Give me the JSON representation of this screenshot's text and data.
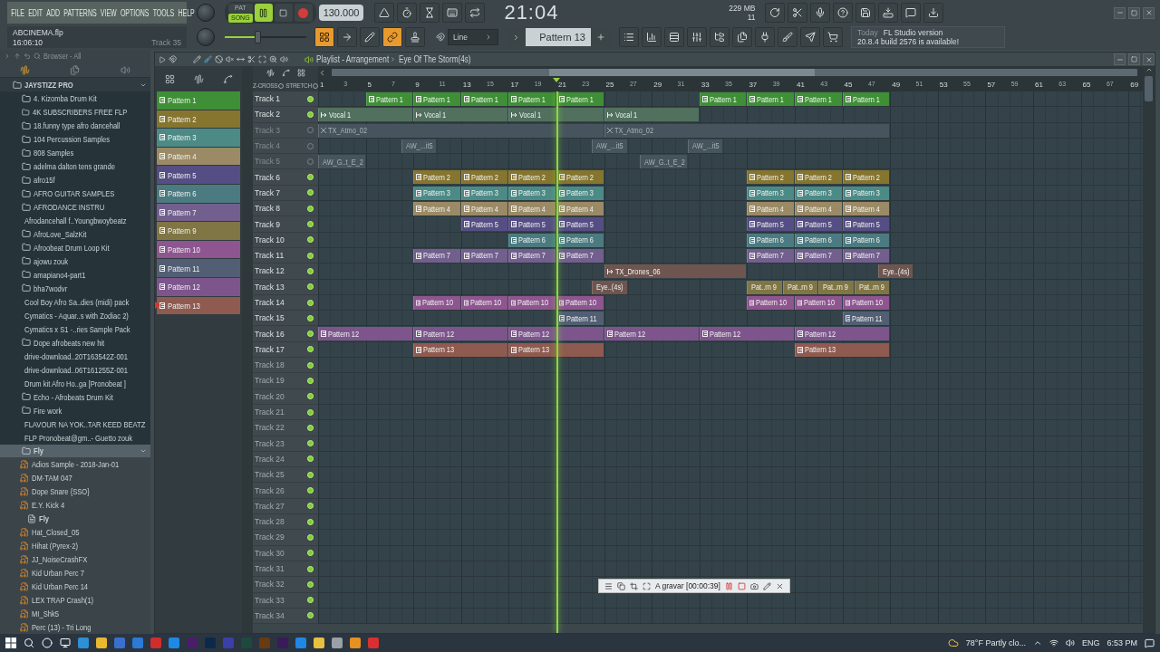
{
  "menu": [
    "FILE",
    "EDIT",
    "ADD",
    "PATTERNS",
    "VIEW",
    "OPTIONS",
    "TOOLS",
    "HELP"
  ],
  "project": {
    "file": "ABCINEMA.flp",
    "time": "16:06:10",
    "hint": "Track 35"
  },
  "modes": [
    {
      "label": "PAT",
      "selected": false
    },
    {
      "label": "SONG",
      "selected": true
    }
  ],
  "transport": {
    "playing": true,
    "tempo": "130.000"
  },
  "master_volume": {
    "level": 0.4
  },
  "clock": {
    "time": "21:04"
  },
  "memory": {
    "ram": "229 MB",
    "voices": "11"
  },
  "mode_buttons": [
    {
      "on": true
    },
    {
      "on": false
    },
    {
      "on": false
    },
    {
      "on": true
    },
    {
      "on": false
    }
  ],
  "snap": {
    "value": "Line"
  },
  "pattern_selector": {
    "value": "Pattern 13"
  },
  "news": {
    "day": "Today",
    "title": "FL Studio version",
    "text": "20.8.4 build 2576 is available!"
  },
  "browser": {
    "title": "Browser - All",
    "tree": [
      {
        "label": "JAYSTIZZ PRO",
        "kind": "folder",
        "expanded": true,
        "selected": false,
        "children": [
          {
            "label": "4. Kizomba Drum Kit",
            "kind": "folder",
            "expanded": false,
            "selected": false
          },
          {
            "label": "4K SUBSCRIBERS FREE FLP",
            "kind": "folder",
            "expanded": false,
            "selected": false
          },
          {
            "label": "18.funny type afro dancehall",
            "kind": "folder",
            "expanded": false,
            "selected": false
          },
          {
            "label": "104 Percussion Samples",
            "kind": "folder",
            "expanded": false,
            "selected": false
          },
          {
            "label": "808 Samples",
            "kind": "folder",
            "expanded": false,
            "selected": false
          },
          {
            "label": "adelma dalton tens grande",
            "kind": "folder",
            "expanded": false,
            "selected": false
          },
          {
            "label": "afro15f",
            "kind": "folder",
            "expanded": false,
            "selected": false
          },
          {
            "label": "AFRO GUITAR SAMPLES",
            "kind": "folder",
            "expanded": false,
            "selected": false
          },
          {
            "label": "AFRODANCE INSTRU",
            "kind": "folder",
            "expanded": false,
            "selected": false
          },
          {
            "label": "Afrodancehall f..Youngbwoybeatz",
            "kind": "folder",
            "expanded": false,
            "selected": false
          },
          {
            "label": "AfroLove_SalzKit",
            "kind": "folder",
            "expanded": false,
            "selected": false
          },
          {
            "label": "Afroobeat Drum Loop Kit",
            "kind": "folder",
            "expanded": false,
            "selected": false
          },
          {
            "label": "ajowu zouk",
            "kind": "folder",
            "expanded": false,
            "selected": false
          },
          {
            "label": "amapiano4-part1",
            "kind": "folder",
            "expanded": false,
            "selected": false
          },
          {
            "label": "bha7wodvr",
            "kind": "folder",
            "expanded": false,
            "selected": false
          },
          {
            "label": "Cool Boy Afro Sa..dies (midi) pack",
            "kind": "folder",
            "expanded": false,
            "selected": false
          },
          {
            "label": "Cymatics - Aquar..s with Zodiac 2)",
            "kind": "folder",
            "expanded": false,
            "selected": false
          },
          {
            "label": "Cymatics x S1 -..ries Sample Pack",
            "kind": "folder",
            "expanded": false,
            "selected": false
          },
          {
            "label": "Dope afrobeats new hit",
            "kind": "folder",
            "expanded": false,
            "selected": false
          },
          {
            "label": "drive-download..20T163542Z-001",
            "kind": "folder",
            "expanded": false,
            "selected": false
          },
          {
            "label": "drive-download..06T161255Z-001",
            "kind": "folder",
            "expanded": false,
            "selected": false
          },
          {
            "label": "Drum kit Afro Ho..ga [Pronobeat ]",
            "kind": "folder",
            "expanded": false,
            "selected": false
          },
          {
            "label": "Echo - Afrobeats Drum Kit",
            "kind": "folder",
            "expanded": false,
            "selected": false
          },
          {
            "label": "Fire work",
            "kind": "folder",
            "expanded": false,
            "selected": false
          },
          {
            "label": "FLAVOUR NA YOK..TAR KEED BEATZ",
            "kind": "folder",
            "expanded": false,
            "selected": false
          },
          {
            "label": "FLP Pronobeat@gm..- Guetto zouk",
            "kind": "folder",
            "expanded": false,
            "selected": false
          },
          {
            "label": "Fly",
            "kind": "folder",
            "expanded": true,
            "selected": true,
            "children": [
              {
                "label": "Adios Sample - 2018-Jan-01",
                "kind": "audio",
                "selected": false
              },
              {
                "label": "DM-TAM 047",
                "kind": "audio",
                "selected": false
              },
              {
                "label": "Dope Snare {SSO}",
                "kind": "audio",
                "selected": false
              },
              {
                "label": "E.Y. Kick 4",
                "kind": "audio",
                "selected": false
              },
              {
                "label": "Fly",
                "kind": "document",
                "selected": false
              },
              {
                "label": "Hat_Closed_05",
                "kind": "audio",
                "selected": false
              },
              {
                "label": "Hihat (Pyrex-2)",
                "kind": "audio",
                "selected": false
              },
              {
                "label": "JJ_NoiseCrashFX",
                "kind": "audio",
                "selected": false
              },
              {
                "label": "Kid Urban Perc 7",
                "kind": "audio",
                "selected": false
              },
              {
                "label": "Kid Urban Perc 14",
                "kind": "audio",
                "selected": false
              },
              {
                "label": "LEX TRAP Crash(1)",
                "kind": "audio",
                "selected": false
              },
              {
                "label": "MI_Shk5",
                "kind": "audio",
                "selected": false
              },
              {
                "label": "Perc (13) - Tri Long",
                "kind": "audio",
                "selected": false
              }
            ]
          }
        ]
      }
    ]
  },
  "playlist": {
    "title": "Playlist - Arrangement",
    "song": "Eye Of The Storm(4s)",
    "zcross": "Z-CROSS",
    "stretch": "STRETCH"
  },
  "patterns": [
    {
      "label": "Pattern 1",
      "color": "#3e8f35",
      "selected": false
    },
    {
      "label": "Pattern 2",
      "color": "#85752f",
      "selected": false
    },
    {
      "label": "Pattern 3",
      "color": "#4c8a86",
      "selected": false
    },
    {
      "label": "Pattern 4",
      "color": "#9b8a66",
      "selected": false
    },
    {
      "label": "Pattern 5",
      "color": "#554e84",
      "selected": false
    },
    {
      "label": "Pattern 6",
      "color": "#4b7a80",
      "selected": false
    },
    {
      "label": "Pattern 7",
      "color": "#725f8e",
      "selected": false
    },
    {
      "label": "Pattern 9",
      "color": "#807545",
      "selected": false
    },
    {
      "label": "Pattern 10",
      "color": "#8e5590",
      "selected": false
    },
    {
      "label": "Pattern 11",
      "color": "#525e73",
      "selected": false
    },
    {
      "label": "Pattern 12",
      "color": "#7d558c",
      "selected": false
    },
    {
      "label": "Pattern 13",
      "color": "#8f5a50",
      "selected": true
    }
  ],
  "ruler": [
    "1",
    "3",
    "5",
    "7",
    "9",
    "11",
    "13",
    "15",
    "17",
    "19",
    "21",
    "23",
    "25",
    "27",
    "29",
    "31",
    "33",
    "35",
    "37",
    "39",
    "41",
    "43",
    "45",
    "47",
    "49",
    "51",
    "53",
    "55",
    "57",
    "59",
    "61",
    "63",
    "65",
    "67",
    "69"
  ],
  "tracks": [
    {
      "name": "Track 1",
      "muted": false,
      "color": "#3e8f35",
      "clips": [
        {
          "kind": "pattern",
          "label": "Pattern 1"
        },
        {
          "kind": "pattern",
          "label": "Pattern 1"
        },
        {
          "kind": "pattern",
          "label": "Pattern 1"
        },
        {
          "kind": "pattern",
          "label": "Pattern 1"
        },
        {
          "kind": "pattern",
          "label": "Pattern 1"
        },
        {
          "kind": "pattern",
          "label": "Pattern 1"
        },
        {
          "kind": "pattern",
          "label": "Pattern 1"
        },
        {
          "kind": "pattern",
          "label": "Pattern 1"
        },
        {
          "kind": "pattern",
          "label": "Pattern 1"
        }
      ]
    },
    {
      "name": "Track 2",
      "muted": false,
      "color": "#51705e",
      "clips": [
        {
          "kind": "audio",
          "label": "Vocal 1"
        },
        {
          "kind": "audio",
          "label": "Vocal 1"
        },
        {
          "kind": "audio",
          "label": "Vocal 1"
        },
        {
          "kind": "audio",
          "label": "Vocal 1"
        }
      ]
    },
    {
      "name": "Track 3",
      "muted": true,
      "color": "#46555d",
      "clips": [
        {
          "kind": "muted",
          "label": "TX_Atmo_02"
        },
        {
          "kind": "muted",
          "label": "TX_Atmo_02"
        }
      ]
    },
    {
      "name": "Track 4",
      "muted": true,
      "color": "#46555d",
      "clips": [
        {
          "kind": "muted",
          "label": "AW_...it5"
        },
        {
          "kind": "muted",
          "label": "AW_...it5"
        },
        {
          "kind": "muted",
          "label": "AW_...it5"
        }
      ]
    },
    {
      "name": "Track 5",
      "muted": true,
      "color": "#46555d",
      "clips": [
        {
          "kind": "muted",
          "label": "AW_G..t_E_2"
        },
        {
          "kind": "muted",
          "label": "AW_G..t_E_2"
        }
      ]
    },
    {
      "name": "Track 6",
      "muted": false,
      "color": "#85752f",
      "clips": [
        {
          "kind": "pattern",
          "label": "Pattern 2"
        },
        {
          "kind": "pattern",
          "label": "Pattern 2"
        },
        {
          "kind": "pattern",
          "label": "Pattern 2"
        },
        {
          "kind": "pattern",
          "label": "Pattern 2"
        },
        {
          "kind": "pattern",
          "label": "Pattern 2"
        },
        {
          "kind": "pattern",
          "label": "Pattern 2"
        },
        {
          "kind": "pattern",
          "label": "Pattern 2"
        }
      ]
    },
    {
      "name": "Track 7",
      "muted": false,
      "color": "#4c8a86",
      "clips": [
        {
          "kind": "pattern",
          "label": "Pattern 3"
        },
        {
          "kind": "pattern",
          "label": "Pattern 3"
        },
        {
          "kind": "pattern",
          "label": "Pattern 3"
        },
        {
          "kind": "pattern",
          "label": "Pattern 3"
        },
        {
          "kind": "pattern",
          "label": "Pattern 3"
        },
        {
          "kind": "pattern",
          "label": "Pattern 3"
        },
        {
          "kind": "pattern",
          "label": "Pattern 3"
        }
      ]
    },
    {
      "name": "Track 8",
      "muted": false,
      "color": "#9b8a66",
      "clips": [
        {
          "kind": "pattern",
          "label": "Pattern 4"
        },
        {
          "kind": "pattern",
          "label": "Pattern 4"
        },
        {
          "kind": "pattern",
          "label": "Pattern 4"
        },
        {
          "kind": "pattern",
          "label": "Pattern 4"
        },
        {
          "kind": "pattern",
          "label": "Pattern 4"
        },
        {
          "kind": "pattern",
          "label": "Pattern 4"
        },
        {
          "kind": "pattern",
          "label": "Pattern 4"
        }
      ]
    },
    {
      "name": "Track 9",
      "muted": false,
      "color": "#554e84",
      "clips": [
        {
          "kind": "pattern",
          "label": "Pattern 5"
        },
        {
          "kind": "pattern",
          "label": "Pattern 5"
        },
        {
          "kind": "pattern",
          "label": "Pattern 5"
        },
        {
          "kind": "pattern",
          "label": "Pattern 5"
        },
        {
          "kind": "pattern",
          "label": "Pattern 5"
        },
        {
          "kind": "pattern",
          "label": "Pattern 5"
        }
      ]
    },
    {
      "name": "Track 10",
      "muted": false,
      "color": "#4b7a80",
      "clips": [
        {
          "kind": "pattern",
          "label": "Pattern 6"
        },
        {
          "kind": "pattern",
          "label": "Pattern 6"
        },
        {
          "kind": "pattern",
          "label": "Pattern 6"
        },
        {
          "kind": "pattern",
          "label": "Pattern 6"
        },
        {
          "kind": "pattern",
          "label": "Pattern 6"
        }
      ]
    },
    {
      "name": "Track 11",
      "muted": false,
      "color": "#725f8e",
      "clips": [
        {
          "kind": "pattern",
          "label": "Pattern 7"
        },
        {
          "kind": "pattern",
          "label": "Pattern 7"
        },
        {
          "kind": "pattern",
          "label": "Pattern 7"
        },
        {
          "kind": "pattern",
          "label": "Pattern 7"
        },
        {
          "kind": "pattern",
          "label": "Pattern 7"
        },
        {
          "kind": "pattern",
          "label": "Pattern 7"
        },
        {
          "kind": "pattern",
          "label": "Pattern 7"
        }
      ]
    },
    {
      "name": "Track 12",
      "muted": false,
      "color": "#6e5550",
      "clips": [
        {
          "kind": "audio",
          "label": "TX_Drones_06"
        },
        {
          "kind": "audio",
          "label": "Eye..(4s)"
        }
      ]
    },
    {
      "name": "Track 13",
      "muted": false,
      "color": "#807545",
      "clips": [
        {
          "kind": "audio",
          "label": "Eye..(4s)",
          "color": "#6e5550"
        },
        {
          "kind": "pattern",
          "label": "Pat..rn 9"
        },
        {
          "kind": "pattern",
          "label": "Pat..rn 9"
        },
        {
          "kind": "pattern",
          "label": "Pat..rn 9"
        },
        {
          "kind": "pattern",
          "label": "Pat..rn 9"
        }
      ]
    },
    {
      "name": "Track 14",
      "muted": false,
      "color": "#8e5590",
      "clips": [
        {
          "kind": "pattern",
          "label": "Pattern 10"
        },
        {
          "kind": "pattern",
          "label": "Pattern 10"
        },
        {
          "kind": "pattern",
          "label": "Pattern 10"
        },
        {
          "kind": "pattern",
          "label": "Pattern 10"
        },
        {
          "kind": "pattern",
          "label": "Pattern 10"
        },
        {
          "kind": "pattern",
          "label": "Pattern 10"
        },
        {
          "kind": "pattern",
          "label": "Pattern 10"
        }
      ]
    },
    {
      "name": "Track 15",
      "muted": false,
      "color": "#525e73",
      "clips": [
        {
          "kind": "pattern",
          "label": "Pattern 11"
        },
        {
          "kind": "pattern",
          "label": "Pattern 11"
        }
      ]
    },
    {
      "name": "Track 16",
      "muted": false,
      "color": "#7d558c",
      "clips": [
        {
          "kind": "pattern",
          "label": "Pattern 12"
        },
        {
          "kind": "pattern",
          "label": "Pattern 12"
        },
        {
          "kind": "pattern",
          "label": "Pattern 12"
        },
        {
          "kind": "pattern",
          "label": "Pattern 12"
        },
        {
          "kind": "pattern",
          "label": "Pattern 12"
        },
        {
          "kind": "pattern",
          "label": "Pattern 12"
        }
      ]
    },
    {
      "name": "Track 17",
      "muted": false,
      "color": "#8f5a50",
      "clips": [
        {
          "kind": "pattern",
          "label": "Pattern 13"
        },
        {
          "kind": "pattern",
          "label": "Pattern 13"
        },
        {
          "kind": "pattern",
          "label": "Pattern 13"
        }
      ]
    },
    {
      "name": "Track 18",
      "muted": false
    },
    {
      "name": "Track 19",
      "muted": false
    },
    {
      "name": "Track 20",
      "muted": false
    },
    {
      "name": "Track 21",
      "muted": false
    },
    {
      "name": "Track 22",
      "muted": false
    },
    {
      "name": "Track 23",
      "muted": false
    },
    {
      "name": "Track 24",
      "muted": false
    },
    {
      "name": "Track 25",
      "muted": false
    },
    {
      "name": "Track 26",
      "muted": false
    },
    {
      "name": "Track 27",
      "muted": false
    },
    {
      "name": "Track 28",
      "muted": false
    },
    {
      "name": "Track 29",
      "muted": false
    },
    {
      "name": "Track 30",
      "muted": false
    },
    {
      "name": "Track 31",
      "muted": false
    },
    {
      "name": "Track 32",
      "muted": false
    },
    {
      "name": "Track 33",
      "muted": false
    },
    {
      "name": "Track 34",
      "muted": false
    }
  ],
  "recorder": {
    "status": "A gravar [00:00:39]"
  },
  "taskbar": {
    "apps": [
      {
        "color": "#2d8fd5"
      },
      {
        "color": "#e8b830"
      },
      {
        "color": "#3a6fd0"
      },
      {
        "color": "#2a7ad6"
      },
      {
        "color": "#d02d2d"
      },
      {
        "color": "#1e88e5"
      },
      {
        "color": "#4a1d6a"
      },
      {
        "color": "#0b2a4a"
      },
      {
        "color": "#3b3fa8"
      },
      {
        "color": "#1d4a3a"
      },
      {
        "color": "#6a3a10"
      },
      {
        "color": "#3a1a5a"
      },
      {
        "color": "#1e88e5"
      },
      {
        "color": "#e8c040"
      },
      {
        "color": "#9aa0a8"
      },
      {
        "color": "#e89020"
      },
      {
        "color": "#d83030"
      }
    ],
    "weather": "78°F  Partly clo...",
    "language": "ENG",
    "time": "6:53 PM"
  }
}
